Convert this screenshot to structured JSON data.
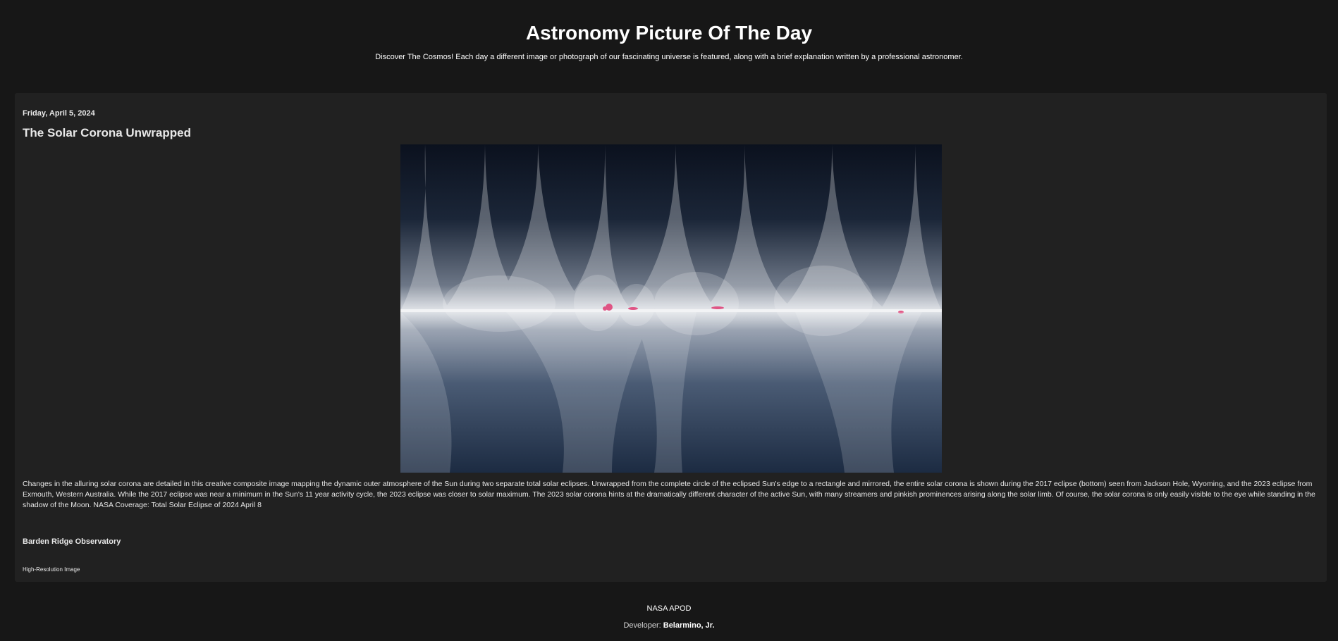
{
  "header": {
    "title": "Astronomy Picture Of The Day",
    "subtitle": "Discover The Cosmos! Each day a different image or photograph of our fascinating universe is featured, along with a brief explanation written by a professional astronomer."
  },
  "post": {
    "date": "Friday, April 5, 2024",
    "title": "The Solar Corona Unwrapped",
    "explanation": "Changes in the alluring solar corona are detailed in this creative composite image mapping the dynamic outer atmosphere of the Sun during two separate total solar eclipses. Unwrapped from the complete circle of the eclipsed Sun's edge to a rectangle and mirrored, the entire solar corona is shown during the 2017 eclipse (bottom) seen from Jackson Hole, Wyoming, and the 2023 eclipse from Exmouth, Western Australia. While the 2017 eclipse was near a minimum in the Sun's 11 year activity cycle, the 2023 eclipse was closer to solar maximum. The 2023 solar corona hints at the dramatically different character of the active Sun, with many streamers and pinkish prominences arising along the solar limb. Of course, the solar corona is only easily visible to the eye while standing in the shadow of the Moon. NASA Coverage: Total Solar Eclipse of 2024 April 8",
    "credit": "Barden Ridge Observatory",
    "hires_label": "High-Resolution Image"
  },
  "footer": {
    "brand": "NASA APOD",
    "developer_label": "Developer:",
    "developer_name": "Belarmino, Jr."
  },
  "colors": {
    "page_background": "#171717",
    "card_background": "#212121",
    "text": "#e8e8e8",
    "prominence_pink": "#e0457a"
  }
}
